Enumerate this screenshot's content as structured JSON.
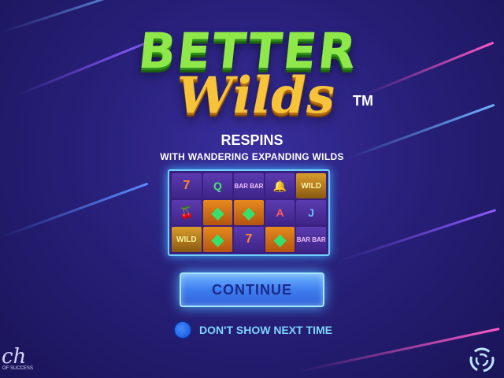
{
  "logo": {
    "line1": "BETTER",
    "line2": "Wilds",
    "trademark": "TM"
  },
  "headline": "RESPINS",
  "subheadline": "WITH WANDERING EXPANDING WILDS",
  "reels": [
    [
      "7",
      "Q",
      "BAR",
      "BELL",
      "WILD"
    ],
    [
      "CHERRY",
      "GEM",
      "GEM",
      "A",
      "J"
    ],
    [
      "WILD",
      "GEM",
      "7",
      "GEM",
      "BAR"
    ]
  ],
  "continue_label": "CONTINUE",
  "dont_show_label": "DON'T SHOW NEXT TIME",
  "brand_left": {
    "mark": "ch",
    "tagline": "OF SUCCESS"
  },
  "colors": {
    "background": "#28207a",
    "button": "#3f7ef0",
    "accent_text": "#7fd4ff"
  }
}
